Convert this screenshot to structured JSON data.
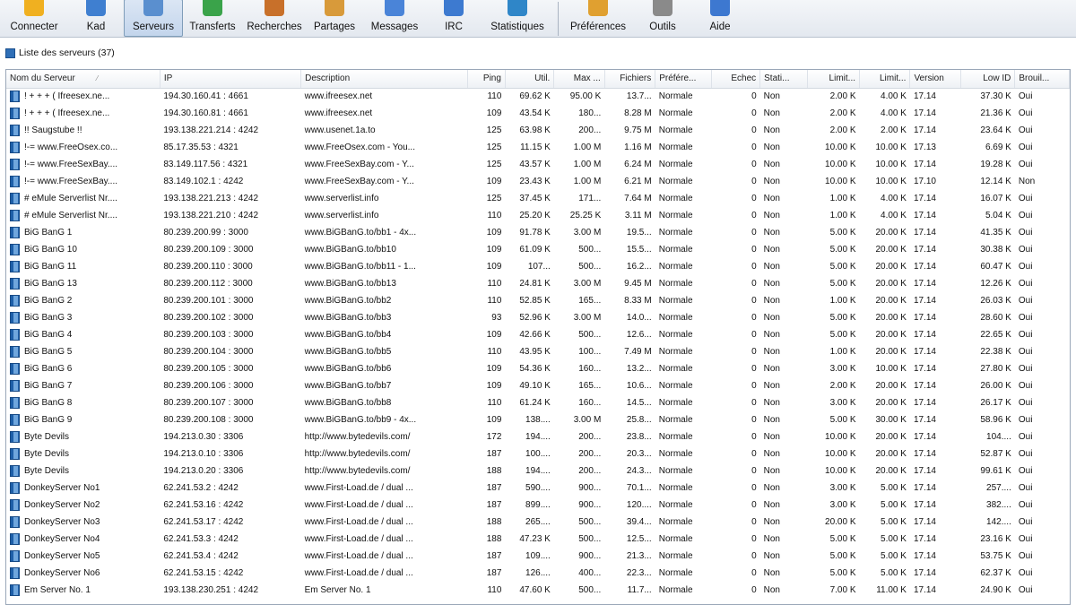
{
  "toolbar": {
    "buttons": [
      {
        "label": "Connecter",
        "icon": "connect-icon",
        "color": "#f0b020"
      },
      {
        "label": "Kad",
        "icon": "kad-icon",
        "color": "#3f7fd0"
      },
      {
        "label": "Serveurs",
        "icon": "servers-icon",
        "color": "#5a8fcf",
        "active": true
      },
      {
        "label": "Transferts",
        "icon": "transfers-icon",
        "color": "#3aa34a"
      },
      {
        "label": "Recherches",
        "icon": "search-icon",
        "color": "#c8702a"
      },
      {
        "label": "Partages",
        "icon": "shares-icon",
        "color": "#d89a3a"
      },
      {
        "label": "Messages",
        "icon": "messages-icon",
        "color": "#4a84d8"
      },
      {
        "label": "IRC",
        "icon": "irc-icon",
        "color": "#3d7ad0"
      },
      {
        "label": "Statistiques",
        "icon": "statistics-icon",
        "color": "#2f86c8"
      },
      {
        "label": "Préférences",
        "icon": "preferences-icon",
        "color": "#e0a030"
      },
      {
        "label": "Outils",
        "icon": "tools-icon",
        "color": "#8a8a8a"
      },
      {
        "label": "Aide",
        "icon": "help-icon",
        "color": "#3d78d0"
      }
    ]
  },
  "list_title": "Liste des serveurs (37)",
  "columns": [
    "Nom du Serveur",
    "IP",
    "Description",
    "Ping",
    "Util.",
    "Max ...",
    "Fichiers",
    "Préfére...",
    "Echec",
    "Stati...",
    "Limit...",
    "Limit...",
    "Version",
    "Low ID",
    "Brouil..."
  ],
  "rows": [
    [
      "! + + + ( Ifreesex.ne...",
      "194.30.160.41 : 4661",
      "www.ifreesex.net",
      "110",
      "69.62 K",
      "95.00 K",
      "13.7...",
      "Normale",
      "0",
      "Non",
      "2.00 K",
      "4.00 K",
      "17.14",
      "37.30 K",
      "Oui"
    ],
    [
      "! + + + ( Ifreesex.ne...",
      "194.30.160.81 : 4661",
      "www.ifreesex.net",
      "109",
      "43.54 K",
      "180...",
      "8.28 M",
      "Normale",
      "0",
      "Non",
      "2.00 K",
      "4.00 K",
      "17.14",
      "21.36 K",
      "Oui"
    ],
    [
      "!! Saugstube !!",
      "193.138.221.214 : 4242",
      "www.usenet.1a.to",
      "125",
      "63.98 K",
      "200...",
      "9.75 M",
      "Normale",
      "0",
      "Non",
      "2.00 K",
      "2.00 K",
      "17.14",
      "23.64 K",
      "Oui"
    ],
    [
      "!-= www.FreeOsex.co...",
      "85.17.35.53 : 4321",
      "www.FreeOsex.com - You...",
      "125",
      "11.15 K",
      "1.00 M",
      "1.16 M",
      "Normale",
      "0",
      "Non",
      "10.00 K",
      "10.00 K",
      "17.13",
      "6.69 K",
      "Oui"
    ],
    [
      "!-= www.FreeSexBay....",
      "83.149.117.56 : 4321",
      "www.FreeSexBay.com - Y...",
      "125",
      "43.57 K",
      "1.00 M",
      "6.24 M",
      "Normale",
      "0",
      "Non",
      "10.00 K",
      "10.00 K",
      "17.14",
      "19.28 K",
      "Oui"
    ],
    [
      "!-= www.FreeSexBay....",
      "83.149.102.1 : 4242",
      "www.FreeSexBay.com - Y...",
      "109",
      "23.43 K",
      "1.00 M",
      "6.21 M",
      "Normale",
      "0",
      "Non",
      "10.00 K",
      "10.00 K",
      "17.10",
      "12.14 K",
      "Non"
    ],
    [
      "# eMule Serverlist Nr....",
      "193.138.221.213 : 4242",
      "www.serverlist.info",
      "125",
      "37.45 K",
      "171...",
      "7.64 M",
      "Normale",
      "0",
      "Non",
      "1.00 K",
      "4.00 K",
      "17.14",
      "16.07 K",
      "Oui"
    ],
    [
      "# eMule Serverlist Nr....",
      "193.138.221.210 : 4242",
      "www.serverlist.info",
      "110",
      "25.20 K",
      "25.25 K",
      "3.11 M",
      "Normale",
      "0",
      "Non",
      "1.00 K",
      "4.00 K",
      "17.14",
      "5.04 K",
      "Oui"
    ],
    [
      "BiG BanG 1",
      "80.239.200.99 : 3000",
      "www.BiGBanG.to/bb1 - 4x...",
      "109",
      "91.78 K",
      "3.00 M",
      "19.5...",
      "Normale",
      "0",
      "Non",
      "5.00 K",
      "20.00 K",
      "17.14",
      "41.35 K",
      "Oui"
    ],
    [
      "BiG BanG 10",
      "80.239.200.109 : 3000",
      "www.BiGBanG.to/bb10",
      "109",
      "61.09 K",
      "500...",
      "15.5...",
      "Normale",
      "0",
      "Non",
      "5.00 K",
      "20.00 K",
      "17.14",
      "30.38 K",
      "Oui"
    ],
    [
      "BiG BanG 11",
      "80.239.200.110 : 3000",
      "www.BiGBanG.to/bb11 - 1...",
      "109",
      "107...",
      "500...",
      "16.2...",
      "Normale",
      "0",
      "Non",
      "5.00 K",
      "20.00 K",
      "17.14",
      "60.47 K",
      "Oui"
    ],
    [
      "BiG BanG 13",
      "80.239.200.112 : 3000",
      "www.BiGBanG.to/bb13",
      "110",
      "24.81 K",
      "3.00 M",
      "9.45 M",
      "Normale",
      "0",
      "Non",
      "5.00 K",
      "20.00 K",
      "17.14",
      "12.26 K",
      "Oui"
    ],
    [
      "BiG BanG 2",
      "80.239.200.101 : 3000",
      "www.BiGBanG.to/bb2",
      "110",
      "52.85 K",
      "165...",
      "8.33 M",
      "Normale",
      "0",
      "Non",
      "1.00 K",
      "20.00 K",
      "17.14",
      "26.03 K",
      "Oui"
    ],
    [
      "BiG BanG 3",
      "80.239.200.102 : 3000",
      "www.BiGBanG.to/bb3",
      "93",
      "52.96 K",
      "3.00 M",
      "14.0...",
      "Normale",
      "0",
      "Non",
      "5.00 K",
      "20.00 K",
      "17.14",
      "28.60 K",
      "Oui"
    ],
    [
      "BiG BanG 4",
      "80.239.200.103 : 3000",
      "www.BiGBanG.to/bb4",
      "109",
      "42.66 K",
      "500...",
      "12.6...",
      "Normale",
      "0",
      "Non",
      "5.00 K",
      "20.00 K",
      "17.14",
      "22.65 K",
      "Oui"
    ],
    [
      "BiG BanG 5",
      "80.239.200.104 : 3000",
      "www.BiGBanG.to/bb5",
      "110",
      "43.95 K",
      "100...",
      "7.49 M",
      "Normale",
      "0",
      "Non",
      "1.00 K",
      "20.00 K",
      "17.14",
      "22.38 K",
      "Oui"
    ],
    [
      "BiG BanG 6",
      "80.239.200.105 : 3000",
      "www.BiGBanG.to/bb6",
      "109",
      "54.36 K",
      "160...",
      "13.2...",
      "Normale",
      "0",
      "Non",
      "3.00 K",
      "10.00 K",
      "17.14",
      "27.80 K",
      "Oui"
    ],
    [
      "BiG BanG 7",
      "80.239.200.106 : 3000",
      "www.BiGBanG.to/bb7",
      "109",
      "49.10 K",
      "165...",
      "10.6...",
      "Normale",
      "0",
      "Non",
      "2.00 K",
      "20.00 K",
      "17.14",
      "26.00 K",
      "Oui"
    ],
    [
      "BiG BanG 8",
      "80.239.200.107 : 3000",
      "www.BiGBanG.to/bb8",
      "110",
      "61.24 K",
      "160...",
      "14.5...",
      "Normale",
      "0",
      "Non",
      "3.00 K",
      "20.00 K",
      "17.14",
      "26.17 K",
      "Oui"
    ],
    [
      "BiG BanG 9",
      "80.239.200.108 : 3000",
      "www.BiGBanG.to/bb9 - 4x...",
      "109",
      "138....",
      "3.00 M",
      "25.8...",
      "Normale",
      "0",
      "Non",
      "5.00 K",
      "30.00 K",
      "17.14",
      "58.96 K",
      "Oui"
    ],
    [
      "Byte Devils",
      "194.213.0.30 : 3306",
      "http://www.bytedevils.com/",
      "172",
      "194....",
      "200...",
      "23.8...",
      "Normale",
      "0",
      "Non",
      "10.00 K",
      "20.00 K",
      "17.14",
      "104....",
      "Oui"
    ],
    [
      "Byte Devils",
      "194.213.0.10 : 3306",
      "http://www.bytedevils.com/",
      "187",
      "100....",
      "200...",
      "20.3...",
      "Normale",
      "0",
      "Non",
      "10.00 K",
      "20.00 K",
      "17.14",
      "52.87 K",
      "Oui"
    ],
    [
      "Byte Devils",
      "194.213.0.20 : 3306",
      "http://www.bytedevils.com/",
      "188",
      "194....",
      "200...",
      "24.3...",
      "Normale",
      "0",
      "Non",
      "10.00 K",
      "20.00 K",
      "17.14",
      "99.61 K",
      "Oui"
    ],
    [
      "DonkeyServer No1",
      "62.241.53.2 : 4242",
      "www.First-Load.de / dual ...",
      "187",
      "590....",
      "900...",
      "70.1...",
      "Normale",
      "0",
      "Non",
      "3.00 K",
      "5.00 K",
      "17.14",
      "257....",
      "Oui"
    ],
    [
      "DonkeyServer No2",
      "62.241.53.16 : 4242",
      "www.First-Load.de / dual ...",
      "187",
      "899....",
      "900...",
      "120....",
      "Normale",
      "0",
      "Non",
      "3.00 K",
      "5.00 K",
      "17.14",
      "382....",
      "Oui"
    ],
    [
      "DonkeyServer No3",
      "62.241.53.17 : 4242",
      "www.First-Load.de / dual ...",
      "188",
      "265....",
      "500...",
      "39.4...",
      "Normale",
      "0",
      "Non",
      "20.00 K",
      "5.00 K",
      "17.14",
      "142....",
      "Oui"
    ],
    [
      "DonkeyServer No4",
      "62.241.53.3 : 4242",
      "www.First-Load.de / dual ...",
      "188",
      "47.23 K",
      "500...",
      "12.5...",
      "Normale",
      "0",
      "Non",
      "5.00 K",
      "5.00 K",
      "17.14",
      "23.16 K",
      "Oui"
    ],
    [
      "DonkeyServer No5",
      "62.241.53.4 : 4242",
      "www.First-Load.de / dual ...",
      "187",
      "109....",
      "900...",
      "21.3...",
      "Normale",
      "0",
      "Non",
      "5.00 K",
      "5.00 K",
      "17.14",
      "53.75 K",
      "Oui"
    ],
    [
      "DonkeyServer No6",
      "62.241.53.15 : 4242",
      "www.First-Load.de / dual ...",
      "187",
      "126....",
      "400...",
      "22.3...",
      "Normale",
      "0",
      "Non",
      "5.00 K",
      "5.00 K",
      "17.14",
      "62.37 K",
      "Oui"
    ],
    [
      "Em Server No. 1",
      "193.138.230.251 : 4242",
      "Em Server No. 1",
      "110",
      "47.60 K",
      "500...",
      "11.7...",
      "Normale",
      "0",
      "Non",
      "7.00 K",
      "11.00 K",
      "17.14",
      "24.90 K",
      "Oui"
    ]
  ]
}
